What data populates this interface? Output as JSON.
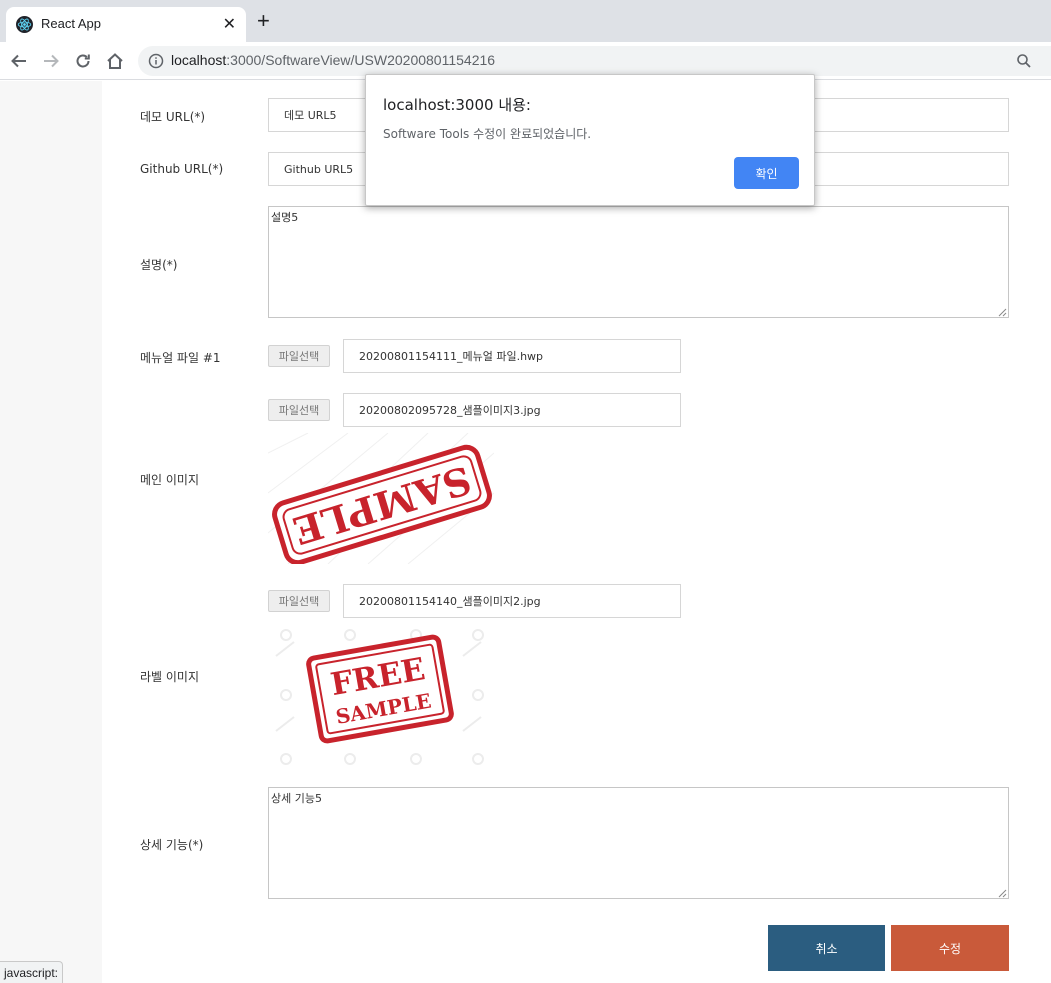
{
  "browser": {
    "tab_title": "React App",
    "tab_close": "✕",
    "new_tab": "+",
    "url_host": "localhost",
    "url_rest": ":3000/SoftwareView/USW20200801154216"
  },
  "form": {
    "demo_url": {
      "label": "데모 URL(*)",
      "value": "데모 URL5"
    },
    "github_url": {
      "label": "Github URL(*)",
      "value": "Github URL5"
    },
    "description": {
      "label": "설명(*)",
      "value": "설명5"
    },
    "manual_file": {
      "label": "메뉴얼 파일 #1",
      "button": "파일선택",
      "filename": "20200801154111_메뉴얼 파일.hwp"
    },
    "main_image": {
      "label": "메인 이미지",
      "button": "파일선택",
      "filename": "20200802095728_샘플이미지3.jpg",
      "stamp_text": "SAMPLE"
    },
    "label_image": {
      "label": "라벨 이미지",
      "button": "파일선택",
      "filename": "20200801154140_샘플이미지2.jpg",
      "stamp_line1": "FREE",
      "stamp_line2": "SAMPLE"
    },
    "detail_features": {
      "label": "상세 기능(*)",
      "value": "상세 기능5"
    }
  },
  "actions": {
    "cancel_label": "취소",
    "submit_label": "수정",
    "cancel_color": "#2b5d80",
    "submit_color": "#c95a3a"
  },
  "status_bar": {
    "text": "javascript:"
  },
  "dialog": {
    "title": "localhost:3000 내용:",
    "message": "Software Tools 수정이 완료되었습니다.",
    "ok_label": "확인"
  }
}
